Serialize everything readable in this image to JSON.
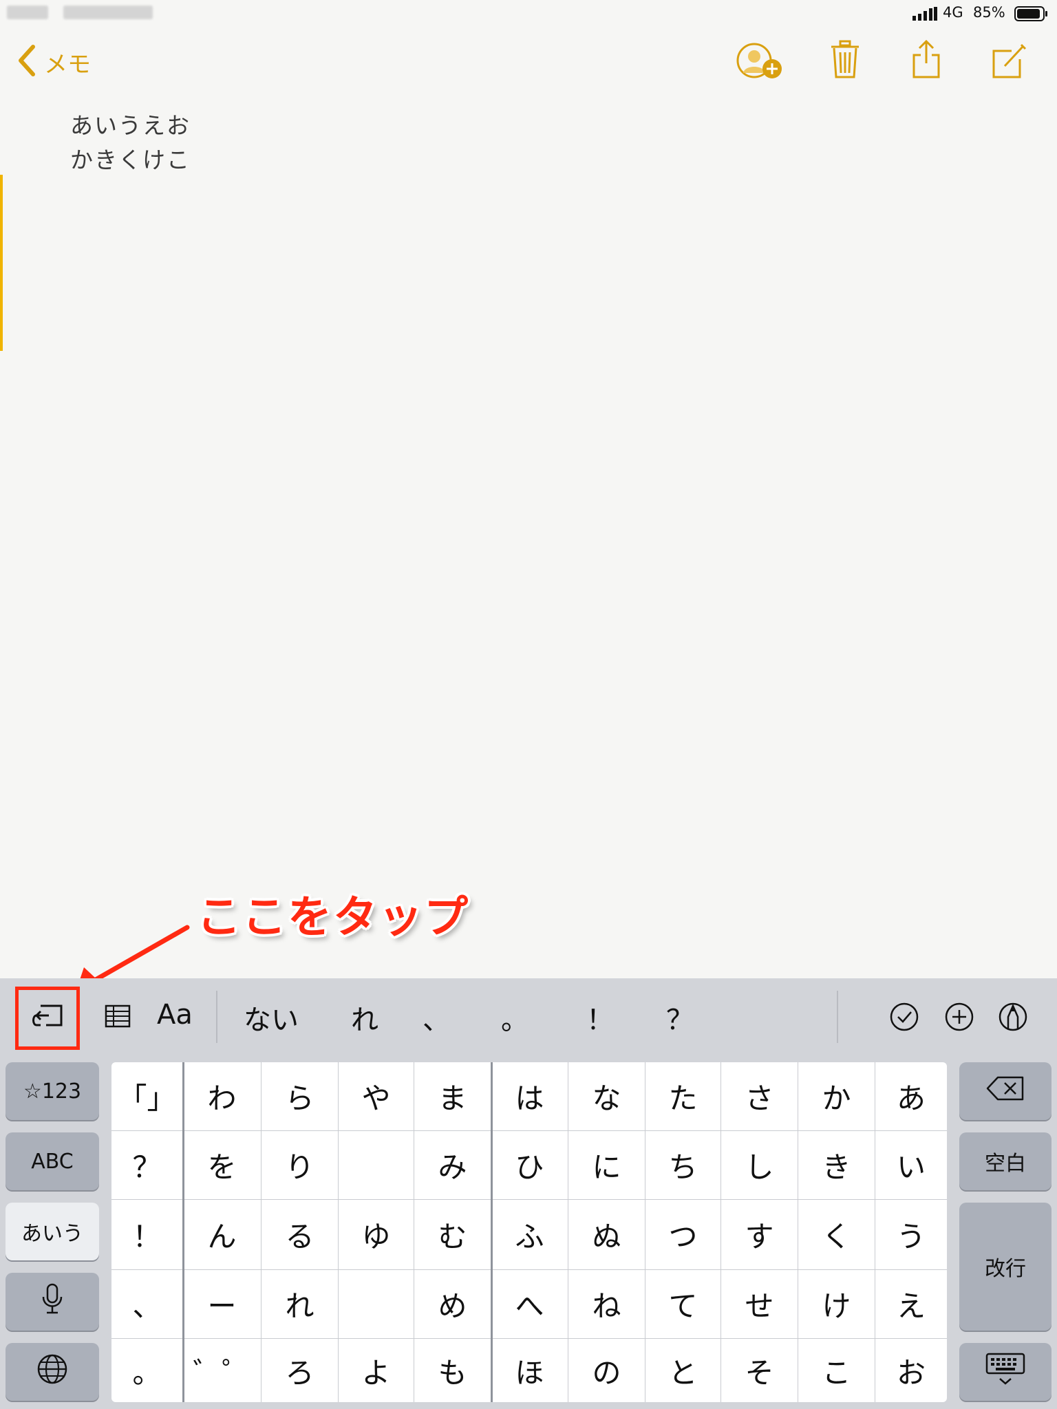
{
  "status_bar": {
    "carrier_blurred": "",
    "network": "4G",
    "battery": "85%"
  },
  "nav": {
    "back_label": "メモ",
    "icons": [
      "add-person-icon",
      "trash-icon",
      "share-icon",
      "compose-icon"
    ]
  },
  "note": {
    "lines": [
      "あいうえお",
      "かきくけこ"
    ]
  },
  "annotation": {
    "text": "ここをタップ",
    "color": "#ff2a12"
  },
  "keyboard_toolbar": {
    "undo_icon": "undo-icon",
    "table_icon": "table-icon",
    "format_label": "Aa",
    "suggestions": [
      "ない",
      "れ",
      "、",
      "。",
      "！",
      "？"
    ],
    "right_icons": [
      "checklist-icon",
      "plus-circle-icon",
      "markup-icon"
    ]
  },
  "keyboard": {
    "left_keys": [
      "☆123",
      "ABC",
      "あいう"
    ],
    "mic_icon": "microphone-icon",
    "globe_icon": "globe-icon",
    "right_keys": {
      "space": "空白",
      "return": "改行"
    },
    "delete_icon": "delete-icon",
    "dismiss_icon": "keyboard-dismiss-icon",
    "grid_rows": [
      [
        "「」",
        "わ",
        "ら",
        "や",
        "ま",
        "は",
        "な",
        "た",
        "さ",
        "か",
        "あ"
      ],
      [
        "？",
        "を",
        "り",
        "",
        "み",
        "ひ",
        "に",
        "ち",
        "し",
        "き",
        "い"
      ],
      [
        "！",
        "ん",
        "る",
        "ゆ",
        "む",
        "ふ",
        "ぬ",
        "つ",
        "す",
        "く",
        "う"
      ],
      [
        "、",
        "ー",
        "れ",
        "",
        "め",
        "へ",
        "ね",
        "て",
        "せ",
        "け",
        "え"
      ],
      [
        "。",
        "゛゜",
        "ろ",
        "よ",
        "も",
        "ほ",
        "の",
        "と",
        "そ",
        "こ",
        "お"
      ]
    ]
  },
  "colors": {
    "accent": "#d9a010",
    "keyboard_bg": "#d2d4d9",
    "annotation_red": "#ff2a12"
  }
}
